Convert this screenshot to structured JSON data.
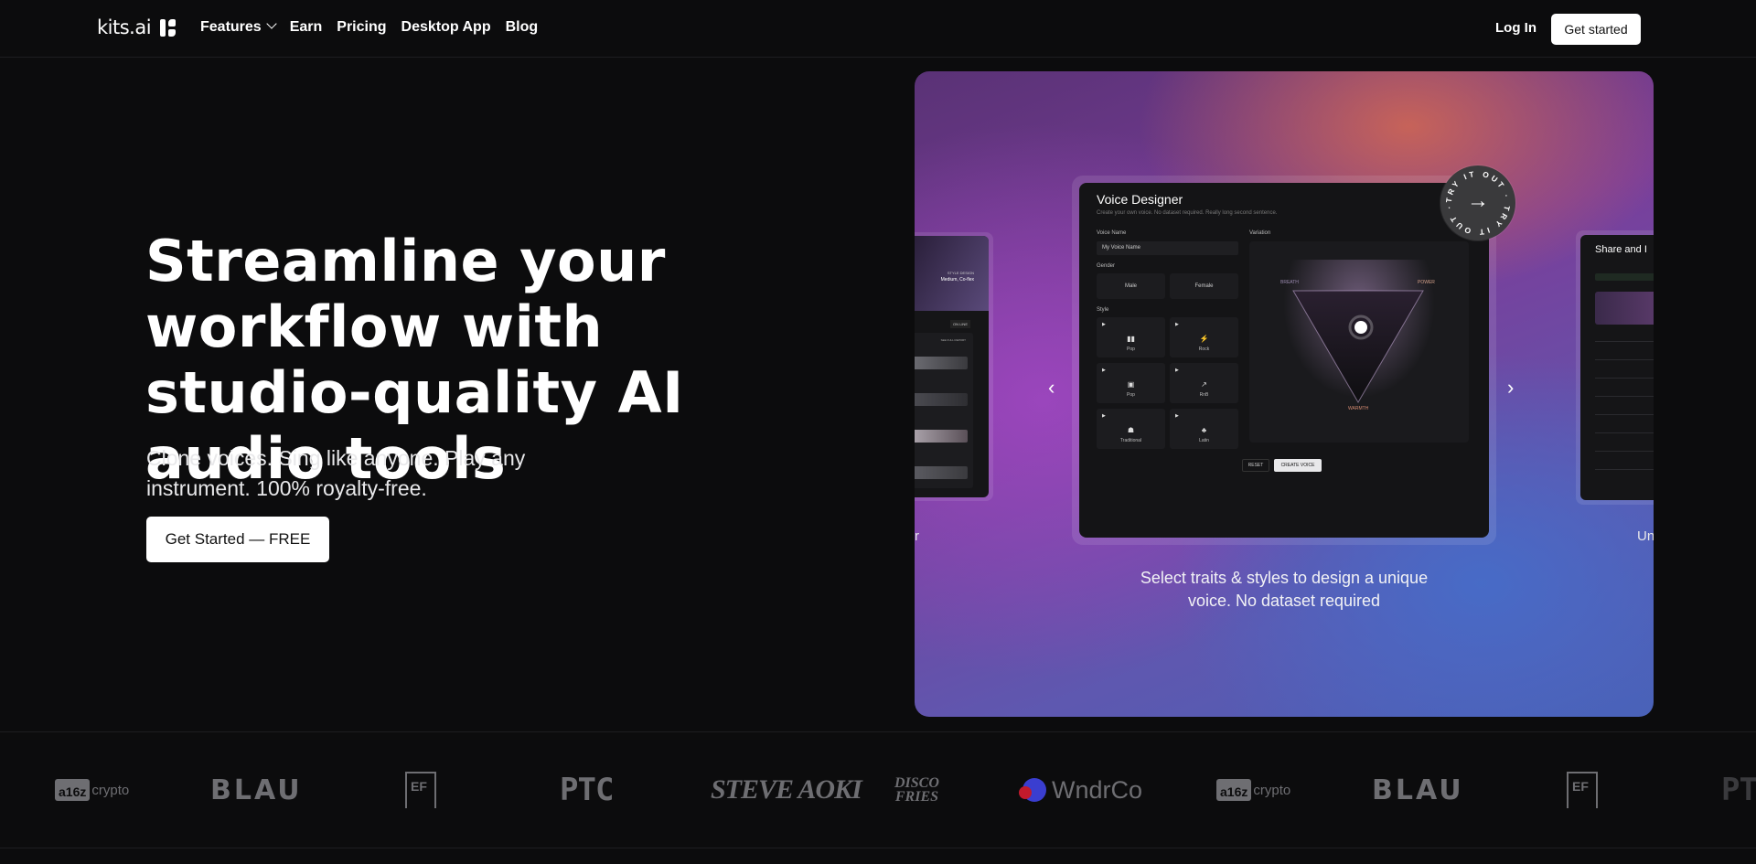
{
  "nav": {
    "logo_text": "kits.ai",
    "links": [
      "Features",
      "Earn",
      "Pricing",
      "Desktop App",
      "Blog"
    ],
    "login": "Log In",
    "get_started": "Get started"
  },
  "hero": {
    "title": "Streamline your workflow with studio-quality AI audio tools",
    "subtitle": "Clone voices. Sing like anyone. Play any instrument.  100% royalty-free.",
    "cta": "Get Started — FREE"
  },
  "showcase": {
    "try_badge": "TRY IT OUT · TRY IT OUT ·",
    "caption": "Select traits & styles to design a unique voice. No dataset required",
    "left_caption": "r",
    "right_caption": "Un",
    "prev_icon": "chevron-left-icon",
    "next_icon": "chevron-right-icon",
    "voice_designer": {
      "title": "Voice Designer",
      "subtitle": "Create your own voice. No dataset required. Really long second sentence.",
      "voice_name_label": "Voice Name",
      "voice_name_value": "My Voice Name",
      "gender_label": "Gender",
      "genders": [
        "Male",
        "Female"
      ],
      "style_label": "Style",
      "styles": [
        "Pop",
        "Rock",
        "Pop",
        "RnB",
        "Traditional",
        "Latin"
      ],
      "variation_label": "Variation",
      "axes": {
        "left": "BREATH",
        "right": "POWER",
        "bottom": "WARMTH"
      },
      "reset": "RESET",
      "create": "CREATE VOICE"
    },
    "left_panel": {
      "meta": "Medium, Co-flex",
      "top": "STYLE DESIGN",
      "badge": "ON LINE",
      "sub": "SEE FULL REPORT"
    },
    "right_panel": {
      "title": "Share and I"
    }
  },
  "logos": [
    "a16z crypto",
    "BLAU",
    "EF",
    "PTC",
    "STEVE AOKI",
    "DISCO FRIES",
    "WndrCo",
    "a16z crypto",
    "BLAU",
    "EF",
    "PT"
  ]
}
